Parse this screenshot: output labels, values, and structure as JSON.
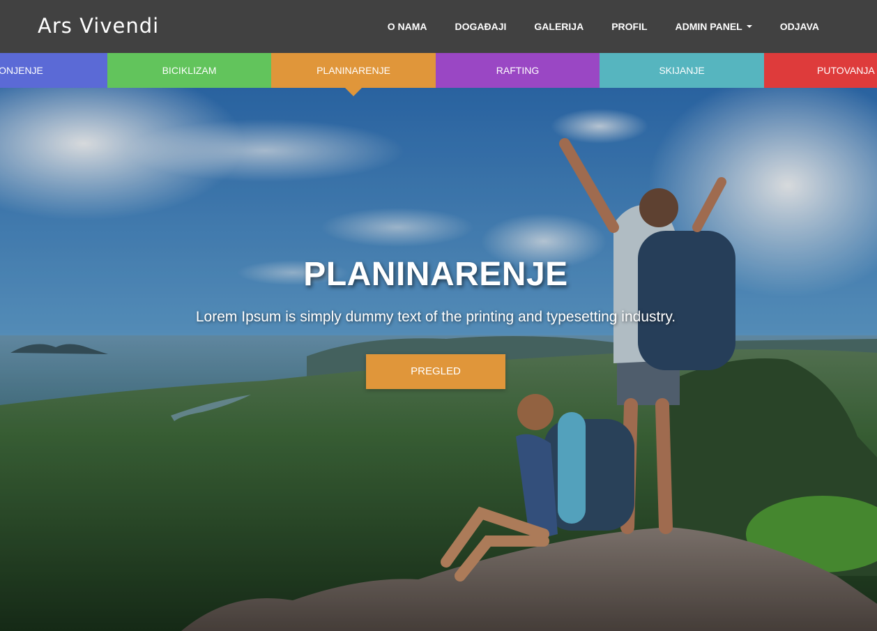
{
  "brand": "Ars Vivendi",
  "nav": {
    "items": [
      {
        "label": "O NAMA"
      },
      {
        "label": "DOGAĐAJI"
      },
      {
        "label": "GALERIJA"
      },
      {
        "label": "PROFIL"
      },
      {
        "label": "ADMIN PANEL"
      },
      {
        "label": "ODJAVA"
      }
    ]
  },
  "categories": [
    {
      "label": "RONJENJE",
      "color": "#5b6ad6"
    },
    {
      "label": "BICIKLIZAM",
      "color": "#62c45c"
    },
    {
      "label": "PLANINARENJE",
      "color": "#e0963a",
      "active": true
    },
    {
      "label": "RAFTING",
      "color": "#9a47c4"
    },
    {
      "label": "SKIJANJE",
      "color": "#56b5bf"
    },
    {
      "label": "PUTOVANJA",
      "color": "#de3b3b"
    }
  ],
  "hero": {
    "title": "PLANINARENJE",
    "subtitle": "Lorem Ipsum is simply dummy text of the printing and typesetting industry.",
    "button_label": "PREGLED"
  },
  "colors": {
    "navbar": "#414141",
    "accent": "#e0963a"
  },
  "icons": {
    "dropdown": "caret-down-icon"
  }
}
